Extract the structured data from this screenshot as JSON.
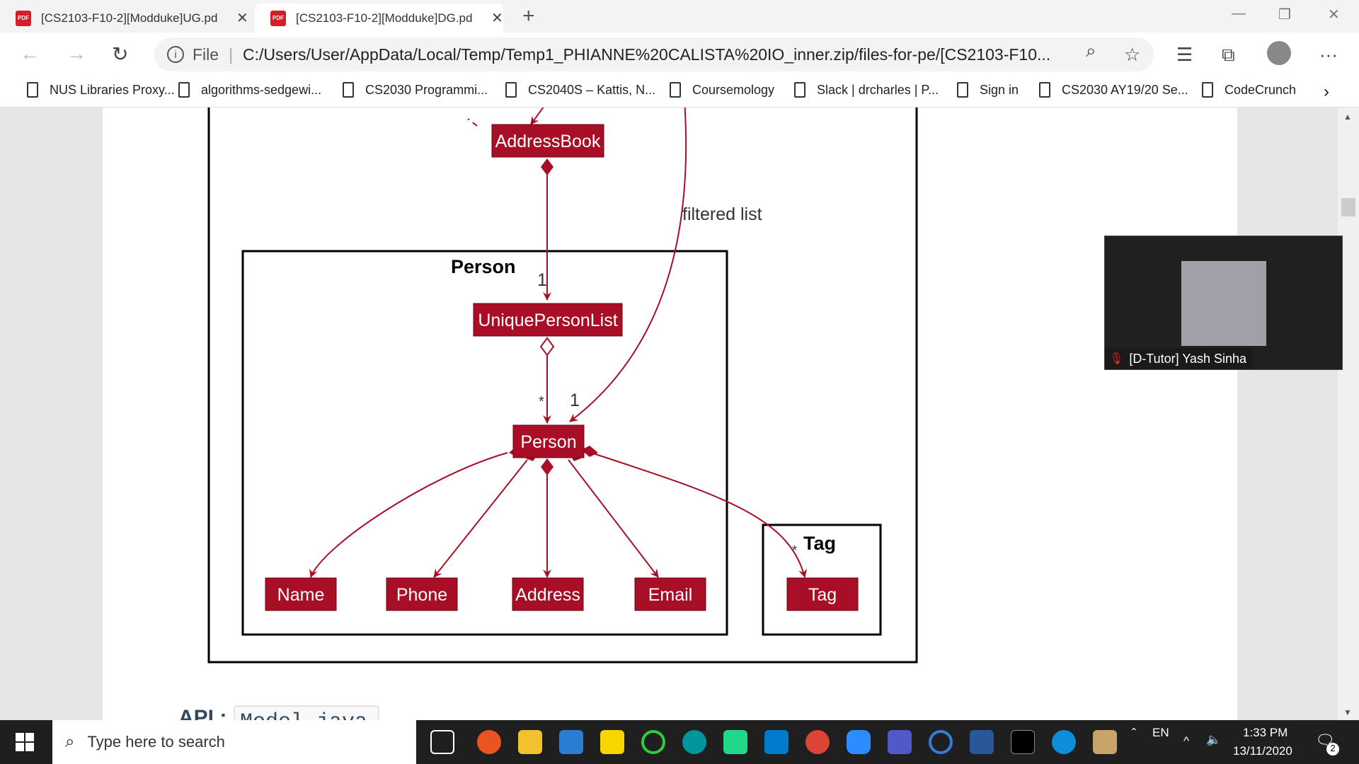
{
  "tabs": [
    {
      "label": "[CS2103-F10-2][Modduke]UG.pd",
      "active": false
    },
    {
      "label": "[CS2103-F10-2][Modduke]DG.pd",
      "active": true
    }
  ],
  "tab_icon": "PDF",
  "address": {
    "prefix": "File",
    "url": "C:/Users/User/AppData/Local/Temp/Temp1_PHIANNE%20CALISTA%20IO_inner.zip/files-for-pe/[CS2103-F10..."
  },
  "bookmarks": [
    "NUS Libraries Proxy...",
    "algorithms-sedgewi...",
    "CS2030 Programmi...",
    "CS2040S – Kattis, N...",
    "Coursemology",
    "Slack | drcharles | P...",
    "Sign in",
    "CS2030 AY19/20 Se...",
    "CodeCrunch"
  ],
  "diagram": {
    "nodes": {
      "address_book": "AddressBook",
      "unique_person_list": "UniquePersonList",
      "person": "Person",
      "name": "Name",
      "phone": "Phone",
      "address": "Address",
      "email": "Email",
      "tag": "Tag"
    },
    "packages": {
      "person": "Person",
      "tag": "Tag"
    },
    "labels": {
      "filtered_list": "filtered list",
      "mult_one_a": "1",
      "mult_star_a": "*",
      "mult_one_b": "1",
      "mult_star_tag": "*"
    },
    "node_color": "#a80e25"
  },
  "api_text": {
    "prefix": "API :",
    "code": "Model.java"
  },
  "video": {
    "participant": "[D-Tutor] Yash Sinha"
  },
  "taskbar": {
    "search_placeholder": "Type here to search",
    "language": "EN",
    "time": "1:33 PM",
    "date": "13/11/2020",
    "notifications": "2"
  }
}
